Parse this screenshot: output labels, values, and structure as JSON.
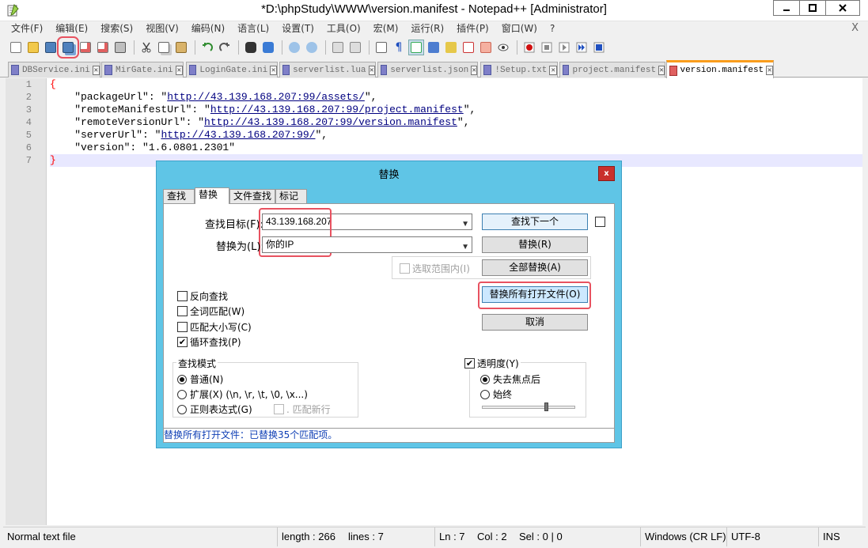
{
  "window": {
    "title": "*D:\\phpStudy\\WWW\\version.manifest - Notepad++ [Administrator]"
  },
  "menu": [
    "文件(F)",
    "编辑(E)",
    "搜索(S)",
    "视图(V)",
    "编码(N)",
    "语言(L)",
    "设置(T)",
    "工具(O)",
    "宏(M)",
    "运行(R)",
    "插件(P)",
    "窗口(W)",
    "?"
  ],
  "menu_close": "X",
  "tabs": [
    {
      "label": "DBService.ini",
      "active": false
    },
    {
      "label": "MirGate.ini",
      "active": false
    },
    {
      "label": "LoginGate.ini",
      "active": false
    },
    {
      "label": "serverlist.lua",
      "active": false
    },
    {
      "label": "serverlist.json",
      "active": false
    },
    {
      "label": "!Setup.txt",
      "active": false
    },
    {
      "label": "project.manifest",
      "active": false
    },
    {
      "label": "version.manifest",
      "active": true
    }
  ],
  "editor": {
    "line_numbers": [
      "1",
      "2",
      "3",
      "4",
      "5",
      "6",
      "7"
    ],
    "lines": [
      {
        "k": "",
        "v": "",
        "u": "",
        "e": ""
      },
      {
        "k": "    \"packageUrl\": \"",
        "u": "http://43.139.168.207:99/assets/",
        "e": "\","
      },
      {
        "k": "    \"remoteManifestUrl\": \"",
        "u": "http://43.139.168.207:99/project.manifest",
        "e": "\","
      },
      {
        "k": "    \"remoteVersionUrl\": \"",
        "u": "http://43.139.168.207:99/version.manifest",
        "e": "\","
      },
      {
        "k": "    \"serverUrl\": \"",
        "u": "http://43.139.168.207:99/",
        "e": "\","
      },
      {
        "k": "    \"version\": \"1.6.0801.2301\"",
        "u": "",
        "e": ""
      },
      {
        "k": "",
        "u": "",
        "e": ""
      }
    ],
    "open_brace": "{",
    "close_brace": "}"
  },
  "status": {
    "file_type": "Normal text file",
    "length": "length : 266",
    "lines": "lines : 7",
    "ln": "Ln : 7",
    "col": "Col : 2",
    "sel": "Sel : 0 | 0",
    "eol": "Windows (CR LF)",
    "encoding": "UTF-8",
    "mode": "INS"
  },
  "dialog": {
    "title": "替换",
    "close": "x",
    "tabs": [
      "查找",
      "替换",
      "文件查找",
      "标记"
    ],
    "find_label": "查找目标(F):",
    "find_value": "43.139.168.207",
    "replace_label": "替换为(L):",
    "replace_value": "你的IP",
    "in_selection": "选取范围内(I)",
    "buttons": {
      "find_next": "查找下一个",
      "replace": "替换(R)",
      "replace_all": "全部替换(A)",
      "replace_all_open": "替换所有打开文件(O)",
      "cancel": "取消"
    },
    "options": {
      "backward": "反向查找",
      "whole_word": "全词匹配(W)",
      "match_case": "匹配大小写(C)",
      "wrap_around": "循环查找(P)"
    },
    "search_mode": {
      "title": "查找模式",
      "normal": "普通(N)",
      "extended": "扩展(X) (\\n, \\r, \\t, \\0, \\x...)",
      "regex": "正则表达式(G)",
      "dot_newline": ". 匹配新行"
    },
    "transparency": {
      "title": "透明度(Y)",
      "on_lose_focus": "失去焦点后",
      "always": "始终"
    },
    "status_message": "替换所有打开文件：已替换35个匹配项。"
  },
  "colors": {
    "dialog_frame": "#5fc5e6",
    "highlight": "#e85260",
    "tab_active_accent": "#fa9d1c",
    "status_text": "#0f3fb5"
  }
}
